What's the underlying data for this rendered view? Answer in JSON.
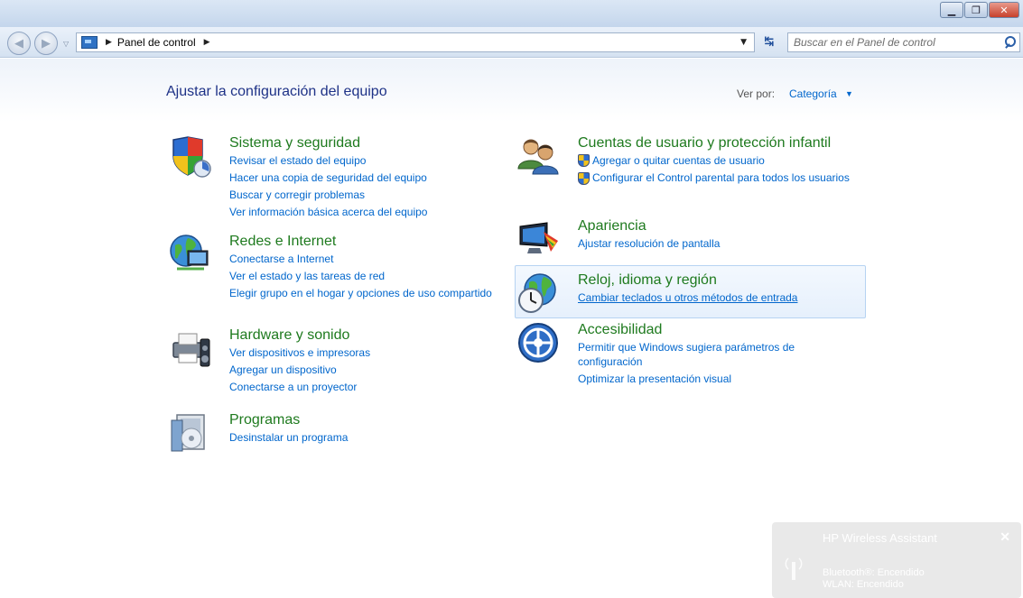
{
  "window": {
    "minimize": "▁",
    "maximize": "❐",
    "close": "✕"
  },
  "nav": {
    "back": "◀",
    "forward": "▶",
    "dropdown": "▽",
    "breadcrumb_sep": "▶",
    "breadcrumb": [
      "Panel de control"
    ],
    "address_dropdown": "▼",
    "refresh": "↹",
    "search_placeholder": "Buscar en el Panel de control"
  },
  "header": {
    "title": "Ajustar la configuración del equipo",
    "view_by_label": "Ver por:",
    "view_by_value": "Categoría",
    "view_by_arrow": "▼"
  },
  "categories_left": [
    {
      "title": "Sistema y seguridad",
      "icon": "shield-icon",
      "links": [
        "Revisar el estado del equipo",
        "Hacer una copia de seguridad del equipo",
        "Buscar y corregir problemas",
        "Ver información básica acerca del equipo"
      ]
    },
    {
      "title": "Redes e Internet",
      "icon": "network-globe-icon",
      "links": [
        "Conectarse a Internet",
        "Ver el estado y las tareas de red",
        "Elegir grupo en el hogar y opciones de uso compartido"
      ]
    },
    {
      "title": "Hardware y sonido",
      "icon": "printer-icon",
      "links": [
        "Ver dispositivos e impresoras",
        "Agregar un dispositivo",
        "Conectarse a un proyector"
      ]
    },
    {
      "title": "Programas",
      "icon": "programs-icon",
      "links": [
        "Desinstalar un programa"
      ]
    }
  ],
  "categories_right": [
    {
      "title": "Cuentas de usuario y protección infantil",
      "icon": "users-icon",
      "links": [
        "Agregar o quitar cuentas de usuario",
        "Configurar el Control parental para todos los usuarios"
      ]
    },
    {
      "title": "Apariencia",
      "icon": "monitor-icon",
      "links": [
        "Ajustar resolución de pantalla"
      ]
    },
    {
      "title": "Reloj, idioma y región",
      "icon": "clock-globe-icon",
      "links": [
        "Cambiar teclados u otros métodos de entrada"
      ]
    },
    {
      "title": "Accesibilidad",
      "icon": "accessibility-icon",
      "links": [
        "Permitir que Windows sugiera parámetros de configuración",
        "Optimizar la presentación visual"
      ]
    }
  ],
  "hp_notification": {
    "title": "HP Wireless Assistant",
    "close": "✕",
    "bluetooth": "Bluetooth®: Encendido",
    "wlan": "WLAN: Encendido"
  }
}
